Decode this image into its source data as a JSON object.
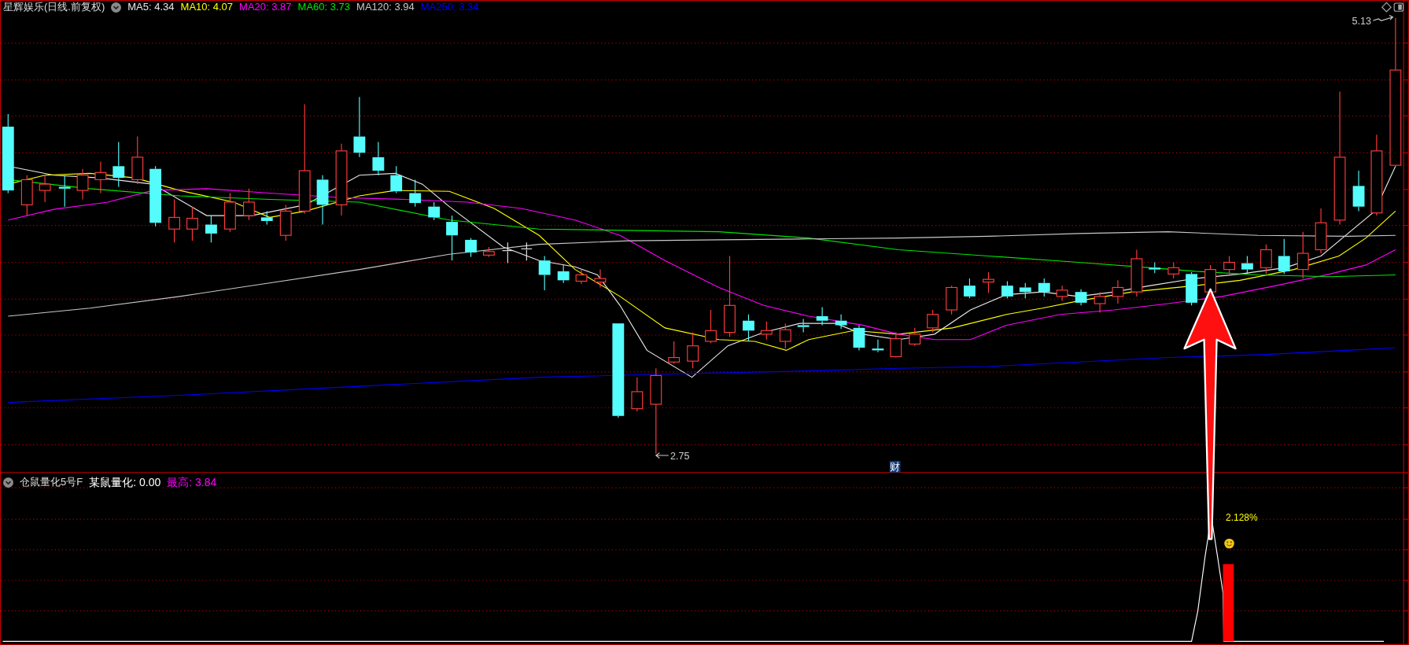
{
  "main_panel": {
    "title": "星辉娱乐(日线.前复权)",
    "moving_averages": [
      {
        "label": "MA5: 4.34",
        "color": "#e8e8e8"
      },
      {
        "label": "MA10: 4.07",
        "color": "#ffff00"
      },
      {
        "label": "MA20: 3.87",
        "color": "#ff00ff"
      },
      {
        "label": "MA60: 3.73",
        "color": "#00e600"
      },
      {
        "label": "MA120: 3.94",
        "color": "#c8c8c8"
      },
      {
        "label": "MA250: 3.34",
        "color": "#0000ff"
      }
    ]
  },
  "annotations": {
    "high_label": "5.13",
    "low_label": "2.75",
    "finance_marker": "财"
  },
  "indicator_panel": {
    "title": "仓鼠量化5号F",
    "readings": [
      {
        "label": "某鼠量化: 0.00",
        "color": "#ffffff"
      },
      {
        "label": "最高: 3.84",
        "color": "#ff00ff"
      }
    ],
    "signal_label": "2.128%"
  }
}
